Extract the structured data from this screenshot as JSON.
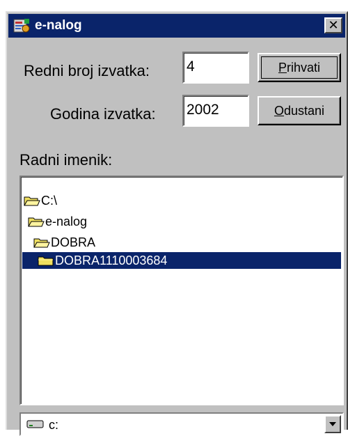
{
  "window": {
    "title": "e-nalog",
    "close_glyph": "✕"
  },
  "form": {
    "redni_label": "Redni broj izvatka:",
    "redni_value": "4",
    "godina_label": "Godina izvatka:",
    "godina_value": "2002",
    "radni_label": "Radni imenik:"
  },
  "buttons": {
    "prihvati_mnemonic": "P",
    "prihvati_rest": "rihvati",
    "odustani_mnemonic": "O",
    "odustani_rest": "dustani"
  },
  "tree": {
    "items": [
      {
        "label": "C:\\",
        "selected": false
      },
      {
        "label": "e-nalog",
        "selected": false
      },
      {
        "label": "DOBRA",
        "selected": false
      },
      {
        "label": "DOBRA1110003684",
        "selected": true
      }
    ]
  },
  "drive": {
    "value": "c:",
    "icon": "drive-icon"
  },
  "colors": {
    "titlebar": "#0a246a",
    "selection": "#0a246a",
    "face": "#c0c0c0",
    "folder": "#f0e060"
  }
}
